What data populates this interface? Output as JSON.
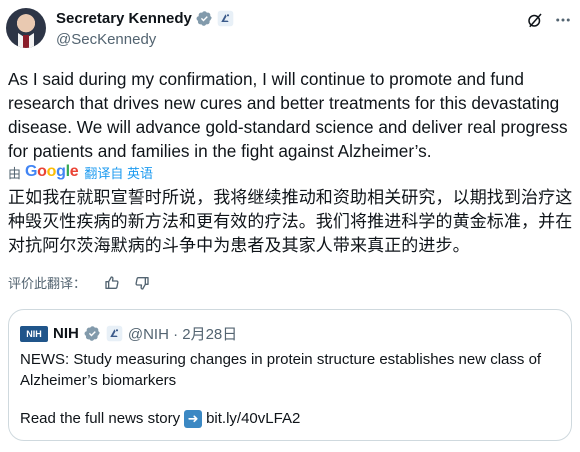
{
  "author": {
    "name": "Secretary Kennedy",
    "handle": "@SecKennedy"
  },
  "tweet": {
    "text": "As I said during my confirmation, I will continue to promote and fund research that drives new cures and better treatments for this devastating disease. We will advance gold-standard science and deliver real progress for patients and families in the fight against Alzheimer’s."
  },
  "translation": {
    "by_label": "由",
    "provider": "Google",
    "translated_from": "翻译自 英语",
    "text": "正如我在就职宣誓时所说，我将继续推动和资助相关研究，以期找到治疗这种毁灭性疾病的新方法和更有效的疗法。我们将推进科学的黄金标准，并在对抗阿尔茨海默病的斗争中为患者及其家人带来真正的进步。",
    "rate_label": "评价此翻译："
  },
  "quote": {
    "logo_text": "NIH",
    "name": "NIH",
    "meta": "@NIH · 2月28日",
    "body": "NEWS: Study measuring changes in protein structure establishes new class of Alzheimer’s biomarkers",
    "link_prefix": "Read the full news story",
    "link": "bit.ly/40vLFA2"
  },
  "colors": {
    "text": "#0f1419",
    "secondary": "#536471",
    "verified_blue": "#1d9bf0",
    "gov_gray": "#829aab",
    "border": "#cfd9de"
  },
  "icons": [
    "verified-badge-icon",
    "government-badge-icon",
    "grok-icon",
    "more-icon",
    "thumbs-up-icon",
    "thumbs-down-icon",
    "right-arrow-emoji-icon"
  ]
}
